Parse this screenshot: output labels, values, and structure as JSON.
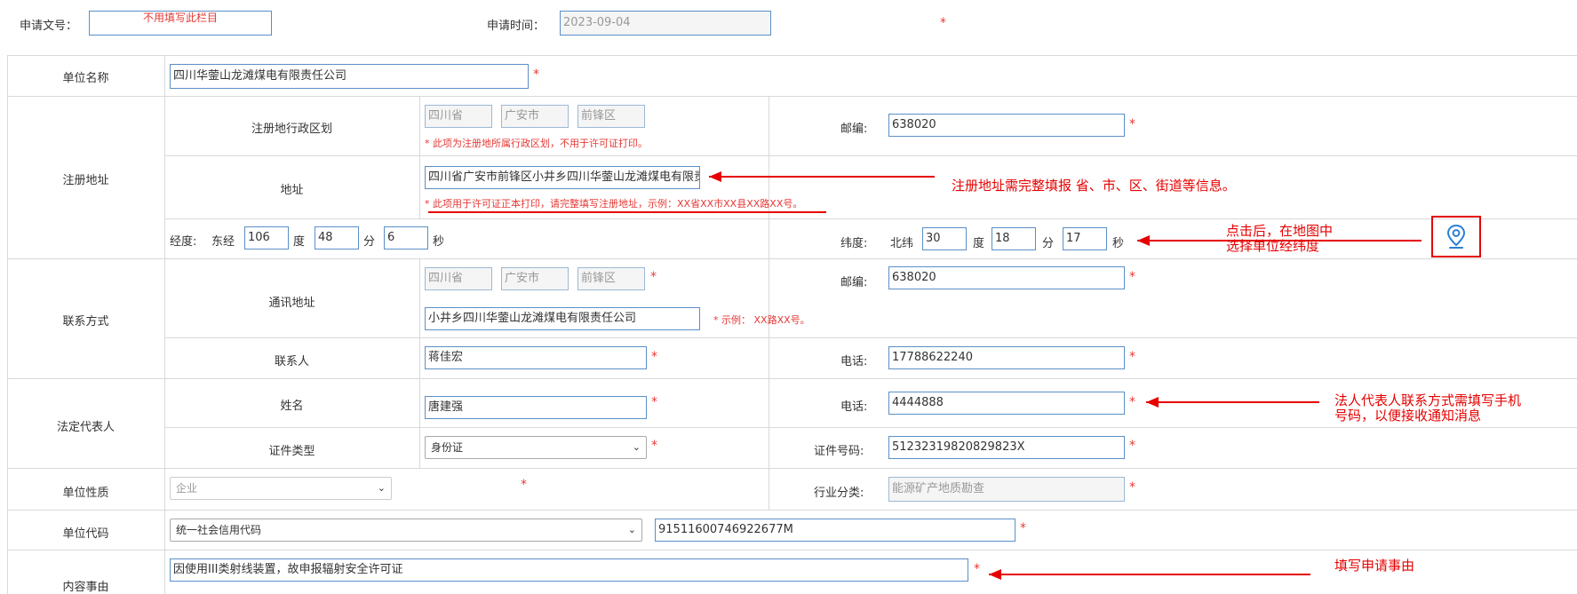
{
  "header": {
    "doc_no_label": "申请文号：",
    "doc_no_placeholder": "不用填写此栏目",
    "apply_time_label": "申请时间：",
    "apply_time_value": "2023-09-04"
  },
  "unit_name": {
    "label": "单位名称",
    "value": "四川华蓥山龙滩煤电有限责任公司"
  },
  "reg_address": {
    "section_label": "注册地址",
    "division_label": "注册地行政区划",
    "province_placeholder": "四川省",
    "city_placeholder": "广安市",
    "district_placeholder": "前锋区",
    "division_hint": "* 此项为注册地所属行政区划，不用于许可证打印。",
    "postcode_label": "邮编:",
    "postcode_value": "638020",
    "address_label": "地址",
    "address_value": "四川省广安市前锋区小井乡四川华蓥山龙滩煤电有限责任公司",
    "address_hint": "* 此项用于许可证正本打印，请完整填写注册地址，示例：XX省XX市XX县XX路XX号。",
    "lng_label": "经度:",
    "lng_dir": "东经",
    "lng_deg": "106",
    "lng_min": "48",
    "lng_sec": "6",
    "deg_unit": "度",
    "min_unit": "分",
    "sec_unit": "秒",
    "lat_label": "纬度:",
    "lat_dir": "北纬",
    "lat_deg": "30",
    "lat_min": "18",
    "lat_sec": "17"
  },
  "contact": {
    "section_label": "联系方式",
    "mail_address_label": "通讯地址",
    "province_placeholder": "四川省",
    "city_placeholder": "广安市",
    "district_placeholder": "前锋区",
    "postcode_label": "邮编:",
    "postcode_value": "638020",
    "street_value": "小井乡四川华蓥山龙滩煤电有限责任公司",
    "street_hint": "* 示例： XX路XX号。",
    "person_label": "联系人",
    "person_value": "蒋佳宏",
    "phone_label": "电话:",
    "phone_value": "17788622240"
  },
  "legal_rep": {
    "section_label": "法定代表人",
    "name_label": "姓名",
    "name_value": "唐建强",
    "phone_label": "电话:",
    "phone_value": "4444888",
    "id_type_label": "证件类型",
    "id_type_value": "身份证",
    "id_no_label": "证件号码:",
    "id_no_value": "51232319820829823X"
  },
  "unit_nature": {
    "label": "单位性质",
    "value": "企业",
    "industry_label": "行业分类:",
    "industry_value": "能源矿产地质勘查"
  },
  "unit_code": {
    "label": "单位代码",
    "type_value": "统一社会信用代码",
    "code_value": "91511600746922677M"
  },
  "content": {
    "label": "内容事由",
    "value": "因使用III类射线装置，故申报辐射安全许可证"
  },
  "annotations": {
    "address_note": "注册地址需完整填报 省、市、区、街道等信息。",
    "map_note_line1": "点击后，在地图中",
    "map_note_line2": "选择单位经纬度",
    "legal_note_line1": "法人代表人联系方式需填写手机",
    "legal_note_line2": "号码，以便接收通知消息",
    "content_note": "填写申请事由"
  },
  "icons": {
    "map_pin": "map-pin-icon"
  },
  "colors": {
    "required": "#e53935",
    "annotation": "#e60000",
    "input_border": "#5b8fc7"
  }
}
